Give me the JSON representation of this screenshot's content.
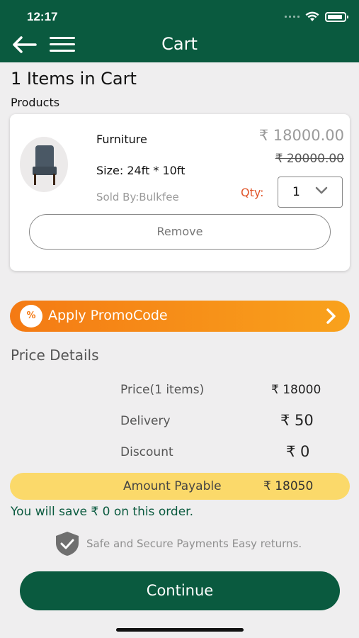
{
  "status_bar": {
    "time": "12:17"
  },
  "nav": {
    "title": "Cart"
  },
  "cart": {
    "count_label": "1 Items in Cart",
    "products_label": "Products"
  },
  "product": {
    "name": "Furniture",
    "size": "Size: 24ft * 10ft",
    "seller": "Sold By:Bulkfee",
    "price": "₹ 18000.00",
    "original_price": "₹ 20000.00",
    "qty_label": "Qty:",
    "qty_value": "1",
    "remove_label": "Remove"
  },
  "promo": {
    "label": "Apply PromoCode",
    "icon_symbol": "%"
  },
  "price_details": {
    "title": "Price Details",
    "rows": [
      {
        "label": "Price(1 items)",
        "value": "₹ 18000"
      },
      {
        "label": "Delivery",
        "value": "₹ 50"
      },
      {
        "label": "Discount",
        "value": "₹ 0"
      }
    ],
    "amount_payable_label": "Amount Payable",
    "amount_payable_value": "₹ 18050"
  },
  "savings": "You will save ₹ 0 on this order.",
  "secure_text": "Safe and Secure Payments Easy returns.",
  "continue_label": "Continue",
  "colors": {
    "primary_green": "#0a5a3f",
    "promo_orange": "#f47a14",
    "amount_yellow": "#fbd96a",
    "qty_red": "#e0552a"
  }
}
